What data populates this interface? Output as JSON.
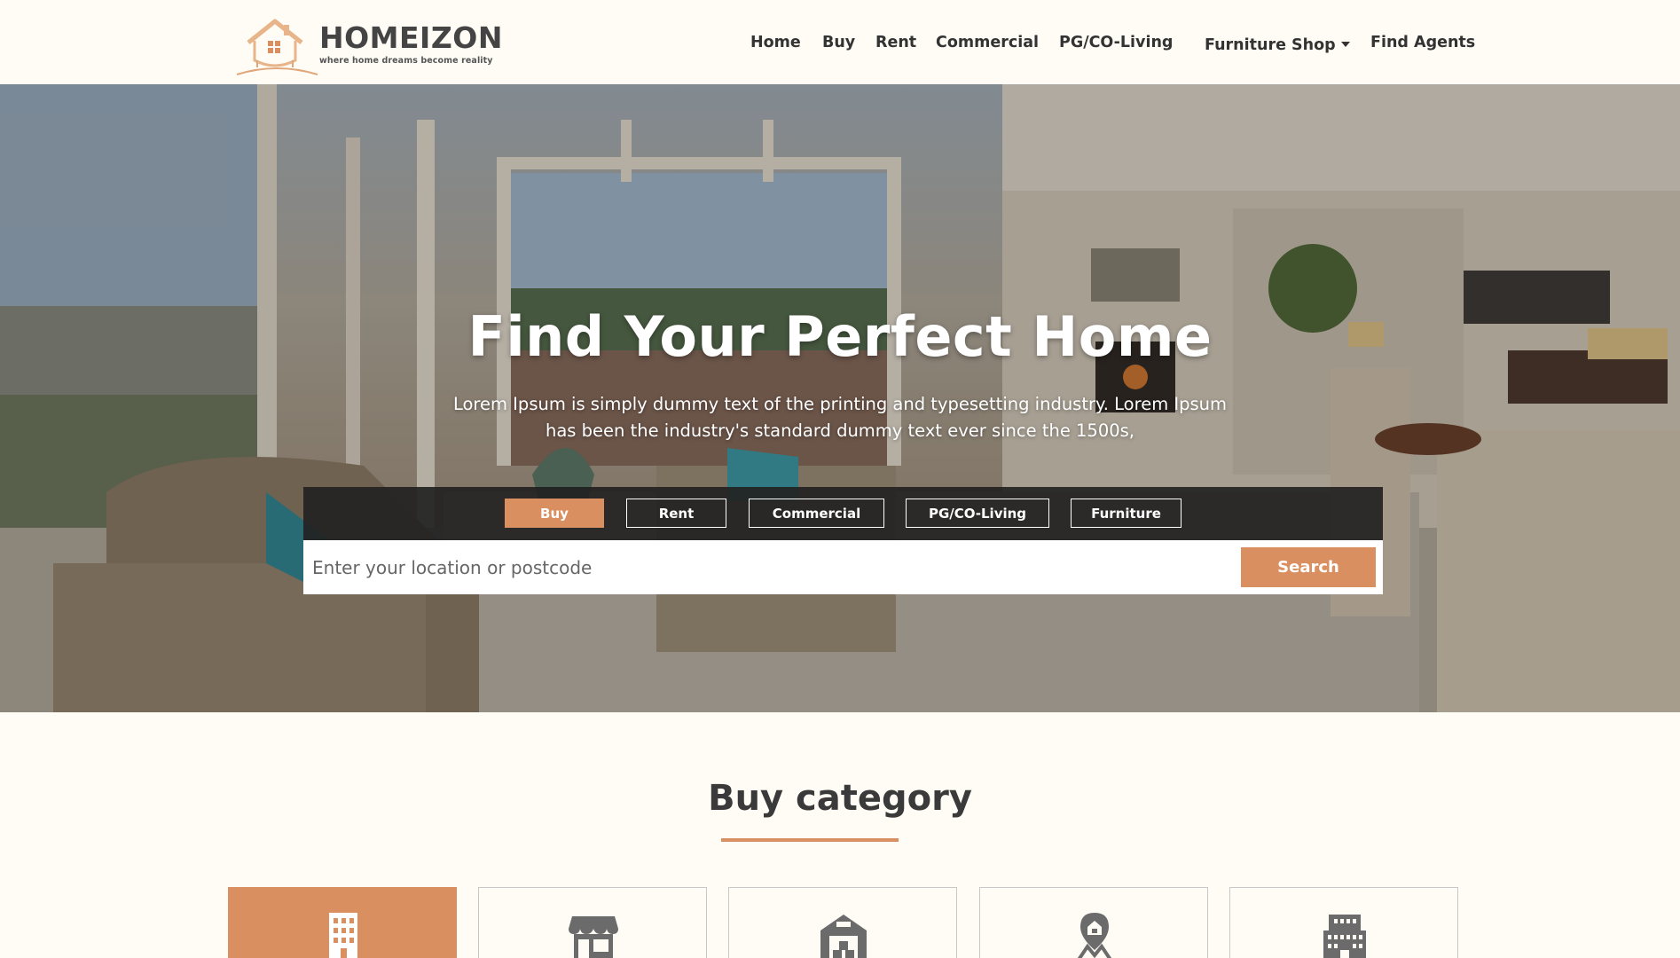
{
  "brand": {
    "name": "HOMEIZON",
    "tagline": "where home dreams become reality",
    "accent_color": "#d98f5f"
  },
  "nav": {
    "items": [
      {
        "label": "Home"
      },
      {
        "label": "Buy"
      },
      {
        "label": "Rent"
      },
      {
        "label": "Commercial"
      },
      {
        "label": "PG/CO-Living"
      },
      {
        "label": "Furniture Shop",
        "dropdown": true
      },
      {
        "label": "Find Agents"
      }
    ]
  },
  "hero": {
    "title": "Find Your Perfect Home",
    "subtitle": "Lorem Ipsum is simply dummy text of the printing and typesetting industry. Lorem Ipsum has been the industry's standard dummy text ever since the 1500s,"
  },
  "search": {
    "tabs": [
      {
        "label": "Buy",
        "active": true
      },
      {
        "label": "Rent",
        "active": false
      },
      {
        "label": "Commercial",
        "active": false
      },
      {
        "label": "PG/CO-Living",
        "active": false
      },
      {
        "label": "Furniture",
        "active": false
      }
    ],
    "placeholder": "Enter your location or postcode",
    "button_label": "Search"
  },
  "categories": {
    "title": "Buy category",
    "cards": [
      {
        "icon": "apartment-building-icon",
        "active": true
      },
      {
        "icon": "shop-storefront-icon",
        "active": false
      },
      {
        "icon": "warehouse-icon",
        "active": false
      },
      {
        "icon": "location-pin-house-icon",
        "active": false
      },
      {
        "icon": "office-building-icon",
        "active": false
      }
    ]
  }
}
